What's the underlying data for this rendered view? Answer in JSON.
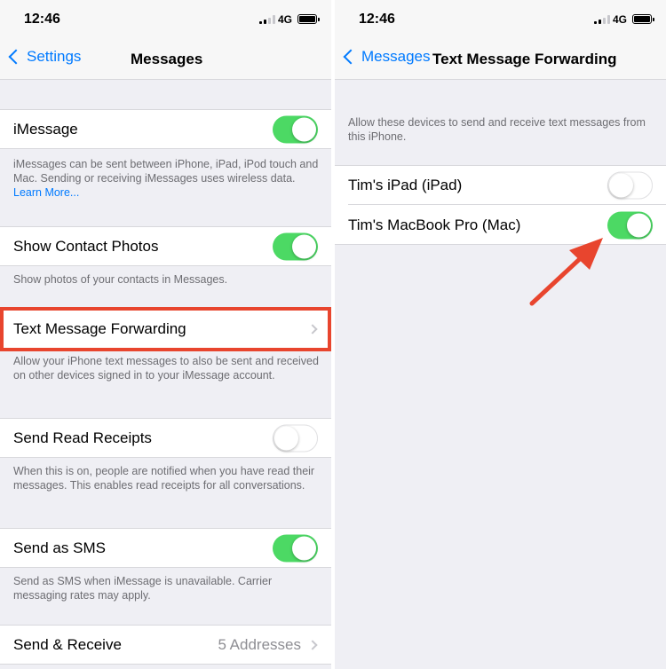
{
  "status_bar": {
    "time": "12:46",
    "network": "4G"
  },
  "left_screen": {
    "nav": {
      "back_label": "Settings",
      "title": "Messages"
    },
    "imessage": {
      "label": "iMessage",
      "enabled": true
    },
    "imessage_footer": {
      "text": "iMessages can be sent between iPhone, iPad, iPod touch and Mac. Sending or receiving iMessages uses wireless data. ",
      "link": "Learn More..."
    },
    "contact_photos": {
      "label": "Show Contact Photos",
      "enabled": true
    },
    "contact_photos_footer": "Show photos of your contacts in Messages.",
    "forwarding": {
      "label": "Text Message Forwarding"
    },
    "forwarding_footer": "Allow your iPhone text messages to also be sent and received on other devices signed in to your iMessage account.",
    "read_receipts": {
      "label": "Send Read Receipts",
      "enabled": false
    },
    "read_receipts_footer": "When this is on, people are notified when you have read their messages. This enables read receipts for all conversations.",
    "send_sms": {
      "label": "Send as SMS",
      "enabled": true
    },
    "send_sms_footer": "Send as SMS when iMessage is unavailable. Carrier messaging rates may apply.",
    "send_receive": {
      "label": "Send & Receive",
      "detail": "5 Addresses"
    }
  },
  "right_screen": {
    "nav": {
      "back_label": "Messages",
      "title": "Text Message Forwarding"
    },
    "header_text": "Allow these devices to send and receive text messages from this iPhone.",
    "devices": [
      {
        "label": "Tim's iPad (iPad)",
        "enabled": false
      },
      {
        "label": "Tim's MacBook Pro (Mac)",
        "enabled": true
      }
    ]
  },
  "colors": {
    "accent": "#007aff",
    "toggle_on": "#4cd964",
    "highlight": "#e8452e",
    "background": "#efeff4"
  },
  "icons": [
    "chevron-left-icon",
    "chevron-right-icon",
    "signal-icon",
    "battery-icon",
    "arrow-annotation-icon"
  ]
}
